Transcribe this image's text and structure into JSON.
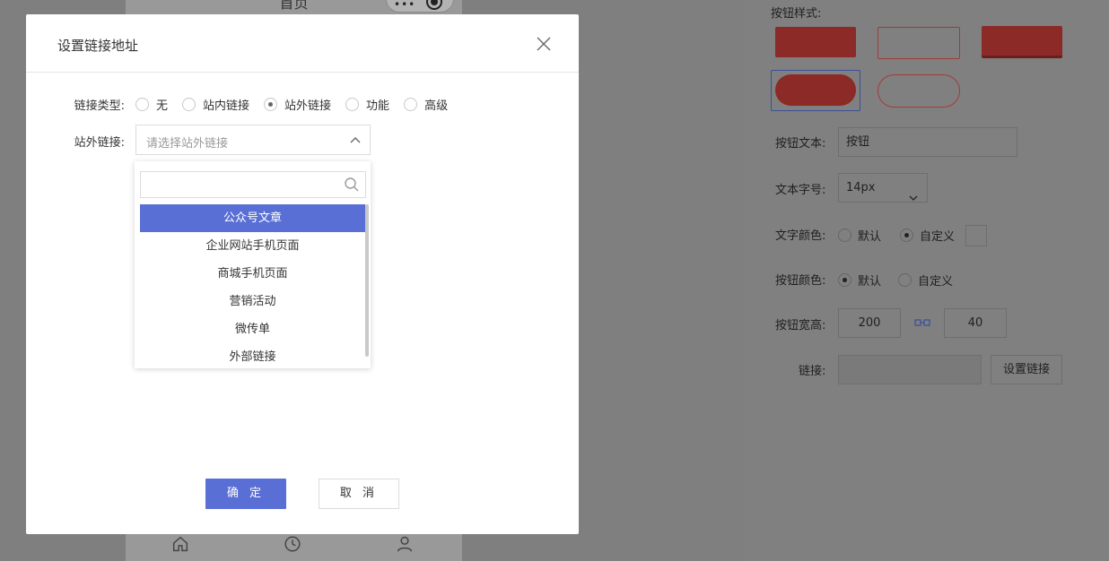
{
  "background": {
    "phone_title": "首页",
    "capsule_dots": "•••",
    "right_panel": {
      "button_style_label": "按钮样式:",
      "button_text_label": "按钮文本:",
      "button_text_value": "按钮",
      "font_size_label": "文本字号:",
      "font_size_value": "14px",
      "text_color_label": "文字颜色:",
      "text_color_options": [
        "默认",
        "自定义"
      ],
      "button_color_label": "按钮颜色:",
      "button_color_options": [
        "默认",
        "自定义"
      ],
      "size_label": "按钮宽高:",
      "width_value": "200",
      "height_value": "40",
      "link_label": "链接:",
      "set_link_button": "设置链接",
      "style_colors": {
        "red": "#8b2a27",
        "red_dark": "#7a2322",
        "outline": "#a33a36"
      }
    }
  },
  "modal": {
    "title": "设置链接地址",
    "link_type_label": "链接类型:",
    "link_types": [
      "无",
      "站内链接",
      "站外链接",
      "功能",
      "高级"
    ],
    "selected_link_type": "站外链接",
    "external_link_label": "站外链接:",
    "select_placeholder": "请选择站外链接",
    "search_placeholder": "",
    "dropdown_items": [
      "公众号文章",
      "企业网站手机页面",
      "商城手机页面",
      "营销活动",
      "微传单",
      "外部链接"
    ],
    "active_item": "公众号文章",
    "confirm_label": "确 定",
    "cancel_label": "取 消"
  },
  "colors": {
    "accent": "#5a6fd6",
    "overlay": "#7f7f7f"
  }
}
